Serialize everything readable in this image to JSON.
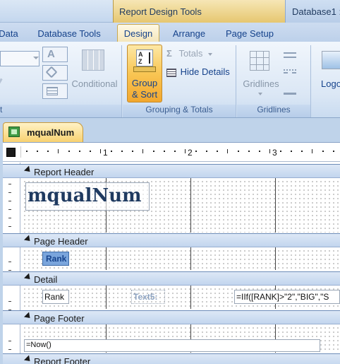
{
  "titlebar": {
    "context_title": "Report Design Tools",
    "db_title": "Database1 :"
  },
  "tabs": [
    {
      "label": "Data"
    },
    {
      "label": "Database Tools"
    },
    {
      "label": "Design",
      "active": true
    },
    {
      "label": "Arrange"
    },
    {
      "label": "Page Setup"
    }
  ],
  "ribbon": {
    "conditional_label": "Conditional",
    "group_sort_label": "Group & Sort",
    "group_sort_line1": "Group",
    "group_sort_line2": "& Sort",
    "totals_label": "Totals",
    "hide_details_label": "Hide Details",
    "gridlines_label": "Gridlines",
    "logo_label": "Logo",
    "group_font_partial": "t",
    "group_grouping_totals": "Grouping & Totals",
    "group_gridlines": "Gridlines"
  },
  "document_tab": {
    "title": "mqualNum"
  },
  "ruler": {
    "marks": [
      "1",
      "2",
      "3"
    ]
  },
  "sections": {
    "report_header": "Report Header",
    "page_header": "Page Header",
    "detail": "Detail",
    "page_footer": "Page Footer",
    "report_footer": "Report Footer"
  },
  "controls": {
    "report_title": "mqualNum",
    "page_header_rank": "Rank",
    "detail_rank": "Rank",
    "detail_text": "Text5:",
    "detail_expr": "=IIf([RANK]>\"2\",\"BIG\",\"S",
    "footer_now": "=Now()"
  },
  "colors": {
    "accent_orange": "#f9c654",
    "ribbon_blue": "#dbe7f5",
    "title_text": "#15428b"
  }
}
